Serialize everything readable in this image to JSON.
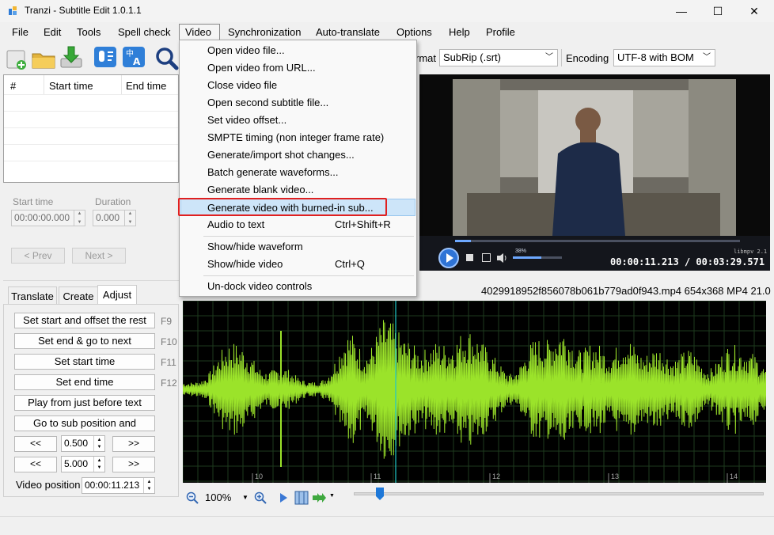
{
  "window": {
    "title": "Tranzi - Subtitle Edit 1.0.1.1",
    "minimize": "—",
    "maximize": "☐",
    "close": "✕"
  },
  "menubar": [
    "File",
    "Edit",
    "Tools",
    "Spell check",
    "Video",
    "Synchronization",
    "Auto-translate",
    "Options",
    "Help",
    "Profile"
  ],
  "toolbar": {
    "icons": [
      "new-file-icon",
      "open-folder-icon",
      "download-icon",
      "speech-icon",
      "translate-icon",
      "search-icon"
    ],
    "format_label": "rmat",
    "format_value": "SubRip (.srt)",
    "encoding_label": "Encoding",
    "encoding_value": "UTF-8 with BOM"
  },
  "subtitle_list": {
    "columns": [
      "#",
      "Start time",
      "End time"
    ]
  },
  "timing": {
    "start_label": "Start time",
    "duration_label": "Duration",
    "start_value": "00:00:00.000",
    "duration_value": "0.000",
    "prev": "< Prev",
    "next": "Next >"
  },
  "tabs": [
    "Translate",
    "Create",
    "Adjust"
  ],
  "adjust": {
    "buttons": [
      {
        "label": "Set start and offset the rest",
        "key": "F9"
      },
      {
        "label": "Set end & go to next",
        "key": "F10"
      },
      {
        "label": "Set start time",
        "key": "F11"
      },
      {
        "label": "Set end time",
        "key": "F12"
      },
      {
        "label": "Play from just before text",
        "key": ""
      },
      {
        "label": "Go to sub position and",
        "key": ""
      }
    ],
    "back": "<<",
    "fwd": ">>",
    "step1": "0.500",
    "step2": "5.000",
    "video_position_label": "Video position",
    "video_position_value": "00:00:11.213"
  },
  "video": {
    "current_time": "00:00:11.213",
    "separator": "/",
    "total_time": "00:03:29.571",
    "volume": "38%",
    "watermark": "libmpv 2.1",
    "file_info": "4029918952f856078b061b779ad0f943.mp4 654x368 MP4 21.0"
  },
  "waveform": {
    "ticks": [
      "10",
      "11",
      "12",
      "13",
      "14"
    ],
    "zoom": "100%",
    "accent": "#9be32a"
  },
  "video_menu": {
    "items": [
      {
        "label": "Open video file...",
        "shortcut": ""
      },
      {
        "label": "Open video from URL...",
        "shortcut": ""
      },
      {
        "label": "Close video file",
        "shortcut": ""
      },
      {
        "label": "Open second subtitle file...",
        "shortcut": ""
      },
      {
        "label": "Set video offset...",
        "shortcut": ""
      },
      {
        "label": "SMPTE timing (non integer frame rate)",
        "shortcut": ""
      },
      {
        "label": "Generate/import shot changes...",
        "shortcut": ""
      },
      {
        "label": "Batch generate waveforms...",
        "shortcut": ""
      },
      {
        "label": "Generate blank video...",
        "shortcut": ""
      },
      {
        "label": "Generate video with burned-in sub...",
        "shortcut": ""
      },
      {
        "label": "Audio to text",
        "shortcut": "Ctrl+Shift+R"
      },
      {
        "label": "Show/hide waveform",
        "shortcut": ""
      },
      {
        "label": "Show/hide video",
        "shortcut": "Ctrl+Q"
      },
      {
        "label": "Un-dock video controls",
        "shortcut": ""
      }
    ]
  }
}
